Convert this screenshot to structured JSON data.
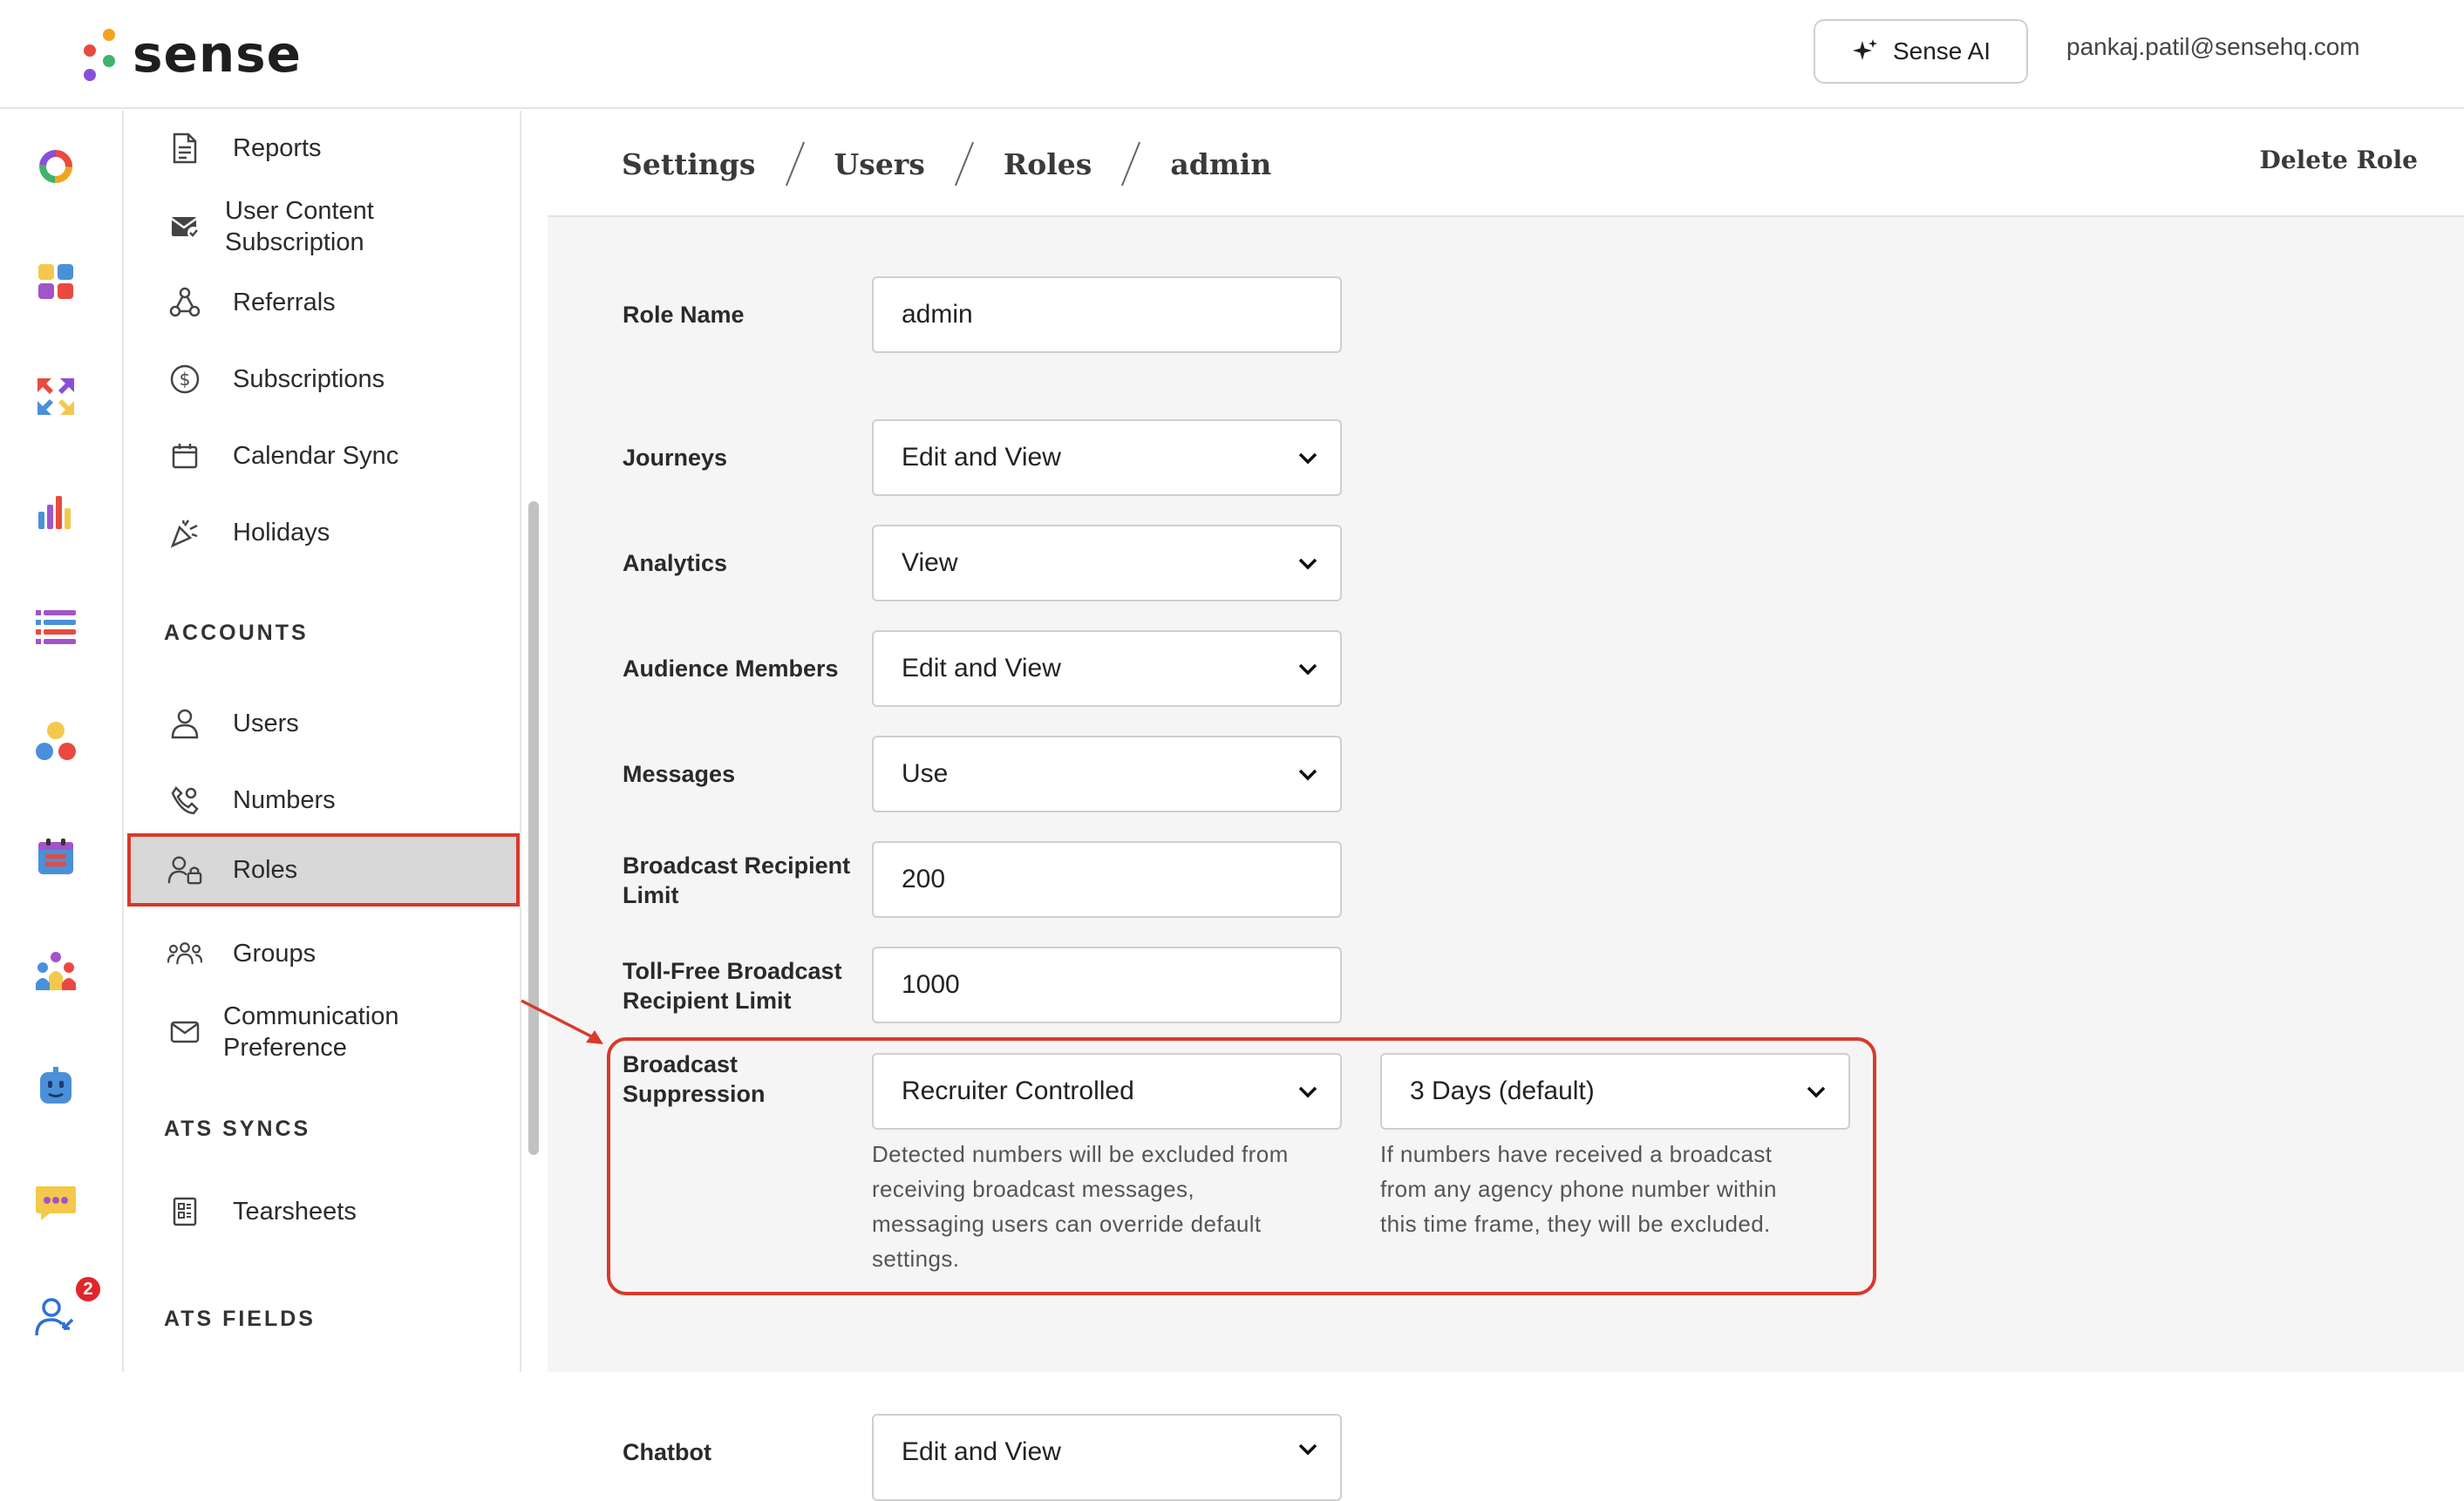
{
  "app": {
    "logo_text": "sense",
    "ai_button_label": "Sense AI",
    "user_email": "pankaj.patil@sensehq.com"
  },
  "rail": {
    "icons": [
      "ring-icon",
      "apps-grid-icon",
      "arrows-icon",
      "bar-chart-icon",
      "list-icon",
      "people-network-icon",
      "calendar-icon",
      "team-icon",
      "bot-icon",
      "chat-icon",
      "contact-sync-icon"
    ],
    "chat_badge": "2"
  },
  "nav": {
    "items_top": [
      {
        "label": "Reports"
      },
      {
        "label": "User Content Subscription"
      },
      {
        "label": "Referrals"
      },
      {
        "label": "Subscriptions"
      },
      {
        "label": "Calendar Sync"
      },
      {
        "label": "Holidays"
      }
    ],
    "section_accounts": "ACCOUNTS",
    "items_accounts": [
      {
        "label": "Users"
      },
      {
        "label": "Numbers"
      },
      {
        "label": "Roles"
      },
      {
        "label": "Groups"
      },
      {
        "label": "Communication Preference"
      }
    ],
    "section_ats_syncs": "ATS SYNCS",
    "items_ats": [
      {
        "label": "Tearsheets"
      }
    ],
    "section_ats_fields": "ATS FIELDS"
  },
  "header": {
    "breadcrumb": [
      "Settings",
      "Users",
      "Roles",
      "admin"
    ],
    "delete_role": "Delete Role"
  },
  "form": {
    "role_name": {
      "label": "Role Name",
      "value": "admin"
    },
    "journeys": {
      "label": "Journeys",
      "value": "Edit and View"
    },
    "analytics": {
      "label": "Analytics",
      "value": "View"
    },
    "audience_members": {
      "label": "Audience Members",
      "value": "Edit and View"
    },
    "messages": {
      "label": "Messages",
      "value": "Use"
    },
    "broadcast_limit": {
      "label_line1": "Broadcast Recipient",
      "label_line2": "Limit",
      "value": "200"
    },
    "tollfree_limit": {
      "label_line1": "Toll-Free Broadcast",
      "label_line2": "Recipient Limit",
      "value": "1000"
    },
    "broadcast_suppression": {
      "label_line1": "Broadcast",
      "label_line2": "Suppression",
      "mode_value": "Recruiter Controlled",
      "mode_help": [
        "Detected numbers will be excluded from",
        "receiving broadcast messages,",
        "messaging users can override default",
        "settings."
      ],
      "window_value": "3 Days (default)",
      "window_help": [
        "If numbers have received a broadcast",
        "from any agency phone number within",
        "this time frame, they will be excluded."
      ]
    },
    "chatbot": {
      "label": "Chatbot",
      "value": "Edit and View"
    }
  },
  "colors": {
    "highlight": "#d8392b",
    "active_nav_bg": "#d8d8d8",
    "badge": "#e0262d"
  }
}
